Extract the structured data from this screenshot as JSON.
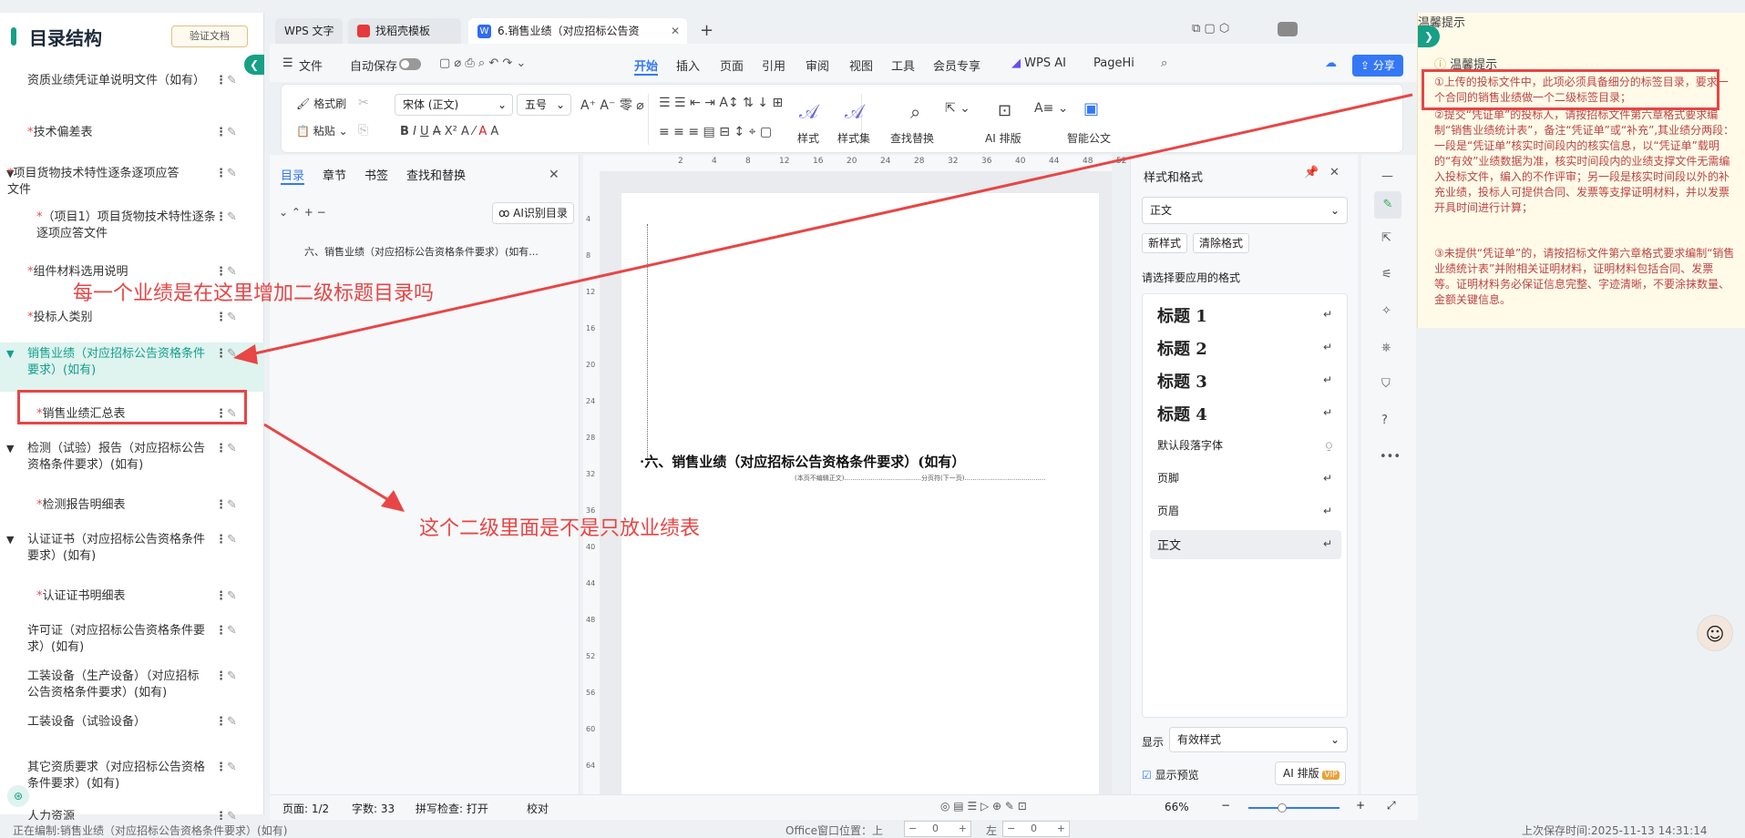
{
  "left_panel": {
    "title": "目录结构",
    "verify_button": "验证文档",
    "items": [
      {
        "label": "资质业绩凭证单说明文件（如有）",
        "star": false,
        "tri": ""
      },
      {
        "label": "技术偏差表",
        "star": true,
        "tri": ""
      },
      {
        "label": "项目货物技术特性逐条逐项应答文件",
        "star": true,
        "tri": "▼"
      },
      {
        "label": "（项目1）项目货物技术特性逐条逐项应答文件",
        "star": true,
        "tri": ""
      },
      {
        "label": "组件材料选用说明",
        "star": true,
        "tri": ""
      },
      {
        "label": "投标人类别",
        "star": true,
        "tri": ""
      },
      {
        "label": "销售业绩（对应招标公告资格条件要求）(如有)",
        "star": false,
        "tri": "▼"
      },
      {
        "label": "销售业绩汇总表",
        "star": true,
        "tri": ""
      },
      {
        "label": "检测（试验）报告（对应招标公告资格条件要求）(如有)",
        "star": false,
        "tri": "▼"
      },
      {
        "label": "检测报告明细表",
        "star": true,
        "tri": ""
      },
      {
        "label": "认证证书（对应招标公告资格条件要求）(如有)",
        "star": false,
        "tri": "▼"
      },
      {
        "label": "认证证书明细表",
        "star": true,
        "tri": ""
      },
      {
        "label": "许可证（对应招标公告资格条件要求）(如有)",
        "star": false,
        "tri": ""
      },
      {
        "label": "工装设备（生产设备）（对应招标公告资格条件要求）(如有)",
        "star": false,
        "tri": ""
      },
      {
        "label": "工装设备（试验设备）",
        "star": false,
        "tri": ""
      },
      {
        "label": "其它资质要求（对应招标公告资格条件要求）(如有)",
        "star": false,
        "tri": ""
      },
      {
        "label": "人力资源",
        "star": false,
        "tri": ""
      }
    ]
  },
  "tabs": {
    "t1": "WPS 文字",
    "t2": "找稻壳模板",
    "t3": "6.销售业绩（对应招标公告资",
    "new": "+"
  },
  "menu": {
    "file": "文件",
    "autosave": "自动保存",
    "items": [
      "开始",
      "插入",
      "页面",
      "引用",
      "审阅",
      "视图",
      "工具",
      "会员专享"
    ],
    "wps_ai": "WPS AI",
    "pagehi": "PageHi",
    "share": "分享"
  },
  "ribbon": {
    "format_painter": "格式刷",
    "paste": "粘贴",
    "font": "宋体 (正文)",
    "size": "五号",
    "style": "样式",
    "style_set": "样式集",
    "find_replace": "查找替换",
    "ai_layout": "AI 排版",
    "smart_doc": "智能公文"
  },
  "nav": {
    "tabs": [
      "目录",
      "章节",
      "书签",
      "查找和替换"
    ],
    "ai_toc": "AI识别目录",
    "entry": "六、销售业绩（对应招标公告资格条件要求）(如有..."
  },
  "ruler": {
    "h": [
      "2",
      "4",
      "8",
      "12",
      "16",
      "20",
      "24",
      "28",
      "32",
      "36",
      "40",
      "44",
      "48",
      "52"
    ],
    "v": [
      "4",
      "8",
      "12",
      "16",
      "20",
      "24",
      "28",
      "32",
      "36",
      "40",
      "44",
      "48",
      "52",
      "56",
      "60",
      "64"
    ]
  },
  "document": {
    "heading": "·六、销售业绩（对应招标公告资格条件要求）(如有）",
    "note": "(本页不编辑正文)......................................分页符(下一页)........................................"
  },
  "styles_pane": {
    "title": "样式和格式",
    "current": "正文",
    "new_style": "新样式",
    "clear_format": "清除格式",
    "prompt": "请选择要应用的格式",
    "items": [
      "标题 1",
      "标题 2",
      "标题 3",
      "标题 4",
      "默认段落字体",
      "页脚",
      "页眉",
      "正文"
    ],
    "show_label": "显示",
    "show_value": "有效样式",
    "preview": "显示预览",
    "ai_btn": "AI 排版",
    "vip": "VIP"
  },
  "tips": {
    "header": "温馨提示",
    "title": "温馨提示",
    "p1": "①上传的投标文件中，此项必须具备细分的标签目录，要求一个合同的销售业绩做一个二级标签目录；",
    "p2": "②提交“凭证单”的投标人，请按招标文件第六章格式要求编制“销售业绩统计表”，备注“凭证单”或“补充”,其业绩分两段：一段是“凭证单”核实时间段内的核实信息，以“凭证单”载明的“有效”业绩数据为准，核实时间段内的业绩支撑文件无需编入投标文件，编入的不作评审；另一段是核实时间段以外的补充业绩，投标人可提供合同、发票等支撑证明材料，并以发票开具时间进行计算；",
    "p3": "③未提供“凭证单”的，请按招标文件第六章格式要求编制“销售业绩统计表”并附相关证明材料，证明材料包括合同、发票等。证明材料务必保证信息完整、字迹清晰，不要涂抹数量、金额关键信息。"
  },
  "status": {
    "page": "页面: 1/2",
    "words": "字数: 33",
    "spell": "拼写检查: 打开",
    "proof": "校对",
    "zoom": "66%"
  },
  "bottom": {
    "editing": "正在编制:销售业绩（对应招标公告资格条件要求）(如有)",
    "office_pos": "Office窗口位置：上",
    "left": "左",
    "v1": "0",
    "v2": "0",
    "saved": "上次保存时间:2025-11-13 14:31:14"
  },
  "annotations": {
    "a1": "每一个业绩是在这里增加二级标题目录吗",
    "a2": "这个二级里面是不是只放业绩表"
  }
}
